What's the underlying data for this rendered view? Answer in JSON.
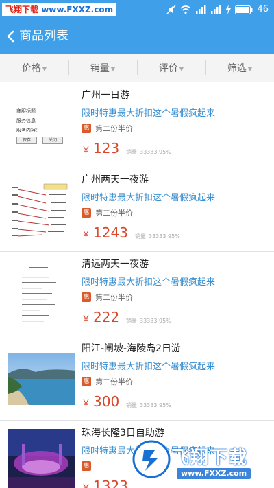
{
  "status_bar": {
    "watermark_left": "飞翔下载",
    "watermark_right": "www.FXXZ.com",
    "battery_text": "46",
    "icons": [
      "mute-icon",
      "wifi-icon",
      "signal-icon",
      "signal-icon",
      "charging-icon",
      "battery-icon"
    ]
  },
  "header": {
    "title": "商品列表",
    "back_icon": "chevron-left-icon"
  },
  "filters": [
    {
      "label": "价格"
    },
    {
      "label": "销量"
    },
    {
      "label": "评价"
    },
    {
      "label": "筛选"
    }
  ],
  "products": [
    {
      "name": "广州一日游",
      "promo": "限时特惠最大折扣这个暑假疯起来",
      "badge": "惠",
      "discount": "第二份半价",
      "currency": "￥",
      "price": "123",
      "sales_label": "销量",
      "sales_value": "33333 95%"
    },
    {
      "name": "广州两天一夜游",
      "promo": "限时特惠最大折扣这个暑假疯起来",
      "badge": "惠",
      "discount": "第二份半价",
      "currency": "￥",
      "price": "1243",
      "sales_label": "销量",
      "sales_value": "33333 95%"
    },
    {
      "name": "清远两天一夜游",
      "promo": "限时特惠最大折扣这个暑假疯起来",
      "badge": "惠",
      "discount": "第二份半价",
      "currency": "￥",
      "price": "222",
      "sales_label": "销量",
      "sales_value": "33333 95%"
    },
    {
      "name": "阳江-闸坡-海陵岛2日游",
      "promo": "限时特惠最大折扣这个暑假疯起来",
      "badge": "惠",
      "discount": "第二份半价",
      "currency": "￥",
      "price": "300",
      "sales_label": "销量",
      "sales_value": "33333 95%"
    },
    {
      "name": "珠海长隆3日自助游",
      "promo": "限时特惠最大折扣这个暑假疯起来",
      "badge": "惠",
      "discount": "",
      "currency": "￥",
      "price": "1323",
      "sales_label": "",
      "sales_value": ""
    }
  ],
  "thumb1": {
    "line1": "商服标题",
    "line2": "服务信息",
    "line3": "服务内容：",
    "btn_save": "保存",
    "btn_close": "关闭"
  },
  "bottom_watermark": {
    "title": "飞翔下载",
    "url": "www.FXXZ.com"
  },
  "colors": {
    "primary": "#3fa0e9",
    "price": "#d9482a",
    "promo": "#3a8fd0",
    "badge": "#d95a2b"
  }
}
